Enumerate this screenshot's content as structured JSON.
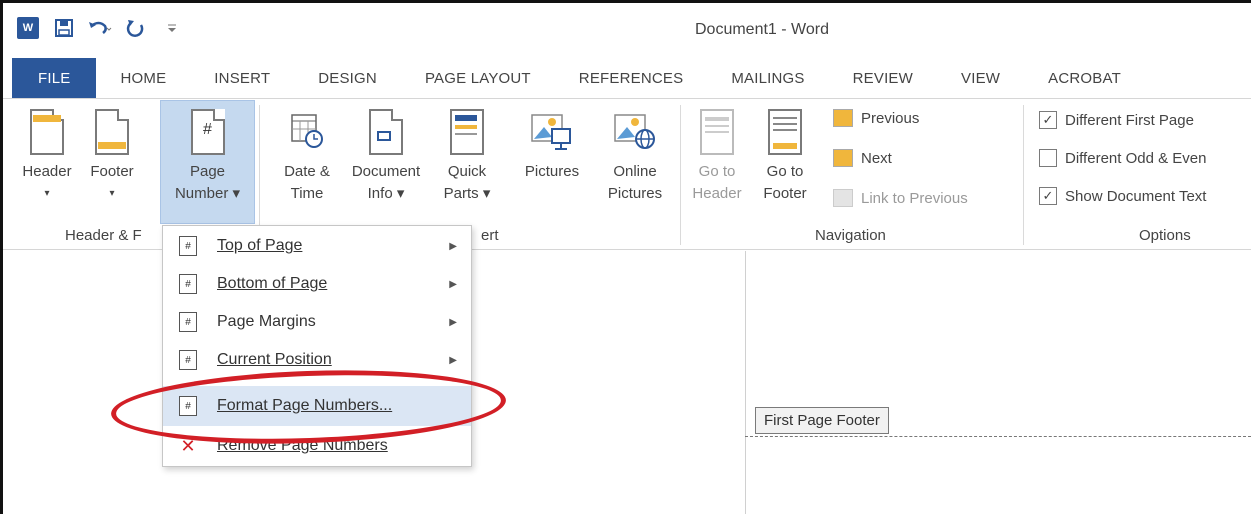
{
  "window": {
    "title": "Document1 - Word"
  },
  "quick_access": {
    "logo": "W",
    "save_icon": "save-icon",
    "undo_icon": "undo-icon",
    "redo_icon": "redo-icon"
  },
  "tabs": [
    "FILE",
    "HOME",
    "INSERT",
    "DESIGN",
    "PAGE LAYOUT",
    "REFERENCES",
    "MAILINGS",
    "REVIEW",
    "VIEW",
    "ACROBAT"
  ],
  "ribbon": {
    "header": {
      "label": "Header"
    },
    "footer": {
      "label": "Footer"
    },
    "page_number": {
      "line1": "Page",
      "line2": "Number ▾"
    },
    "date_time": {
      "line1": "Date &",
      "line2": "Time"
    },
    "document_info": {
      "line1": "Document",
      "line2": "Info ▾"
    },
    "quick_parts": {
      "line1": "Quick",
      "line2": "Parts ▾"
    },
    "pictures": {
      "line1": "Pictures"
    },
    "online_pictures": {
      "line1": "Online",
      "line2": "Pictures"
    },
    "go_to_header": {
      "line1": "Go to",
      "line2": "Header"
    },
    "go_to_footer": {
      "line1": "Go to",
      "line2": "Footer"
    },
    "previous": "Previous",
    "next": "Next",
    "link_to_previous": "Link to Previous",
    "opt_first_page": {
      "label": "Different First Page",
      "checked": true
    },
    "opt_odd_even": {
      "label": "Different Odd & Even",
      "checked": false
    },
    "opt_show_text": {
      "label": "Show Document Text",
      "checked": true
    },
    "groups": {
      "header_footer": "Header & F",
      "insert": "ert",
      "navigation": "Navigation",
      "options": "Options"
    },
    "check_mark": "✓"
  },
  "menu": {
    "items": [
      {
        "label": "Top of Page",
        "has_submenu": true
      },
      {
        "label": "Bottom of Page",
        "has_submenu": true
      },
      {
        "label": "Page Margins",
        "has_submenu": true
      },
      {
        "label": "Current Position",
        "has_submenu": true
      },
      {
        "label": "Format Page Numbers...",
        "has_submenu": false
      },
      {
        "label": "Remove Page Numbers",
        "has_submenu": false
      }
    ],
    "arrow": "▶"
  },
  "document": {
    "footer_tag": "First Page Footer"
  },
  "colors": {
    "accent": "#2b579a",
    "highlight_ring": "#d21f26",
    "menu_highlight": "#dbe6f4"
  }
}
